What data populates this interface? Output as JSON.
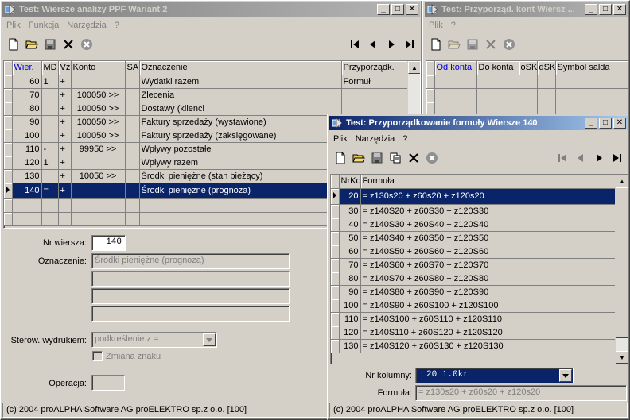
{
  "win1": {
    "title": "Test: Wiersze analizy PPF Wariant 2",
    "menu": [
      "Plik",
      "Funkcja",
      "Narzędzia",
      "?"
    ],
    "columns": [
      "Wier.",
      "MD",
      "Vz",
      "Konto",
      "SA",
      "Oznaczenie",
      "Przyporządk."
    ],
    "rows": [
      {
        "wier": "60",
        "md": "1",
        "vz": "+",
        "konto": "",
        "sa": "",
        "ozn": "Wydatki razem",
        "przyp": "Formuł"
      },
      {
        "wier": "70",
        "md": "",
        "vz": "+",
        "konto": "100050 >>",
        "sa": "",
        "ozn": "Zlecenia",
        "przyp": ""
      },
      {
        "wier": "80",
        "md": "",
        "vz": "+",
        "konto": "100050 >>",
        "sa": "",
        "ozn": "Dostawy (klienci",
        "przyp": ""
      },
      {
        "wier": "90",
        "md": "",
        "vz": "+",
        "konto": "100050 >>",
        "sa": "",
        "ozn": "Faktury sprzedaży (wystawione)",
        "przyp": ""
      },
      {
        "wier": "100",
        "md": "",
        "vz": "+",
        "konto": "100050 >>",
        "sa": "",
        "ozn": "Faktury sprzedaży (zaksięgowane)",
        "przyp": ""
      },
      {
        "wier": "110",
        "md": "-",
        "vz": "+",
        "konto": "99950 >>",
        "sa": "",
        "ozn": "Wpływy pozostałe",
        "przyp": ""
      },
      {
        "wier": "120",
        "md": "1",
        "vz": "+",
        "konto": "",
        "sa": "",
        "ozn": "Wpływy razem",
        "przyp": ""
      },
      {
        "wier": "130",
        "md": "",
        "vz": "+",
        "konto": "10050 >>",
        "sa": "",
        "ozn": "Środki pieniężne (stan bieżący)",
        "przyp": ""
      },
      {
        "wier": "140",
        "md": "=",
        "vz": "+",
        "konto": "",
        "sa": "",
        "ozn": "Środki pieniężne (prognoza)",
        "przyp": ""
      }
    ],
    "form": {
      "nr_label": "Nr wiersza:",
      "nr_value": "140",
      "ozn_label": "Oznaczenie:",
      "ozn_value": "Środki pieniężne (prognoza)",
      "ster_label": "Sterow. wydrukiem:",
      "ster_value": "podkreślenie z =",
      "zmiana_label": "Zmiana znaku",
      "oper_label": "Operacja:"
    },
    "status": "(c) 2004 proALPHA Software AG  proELEKTRO sp.z o.o. [100]"
  },
  "win2": {
    "title": "Test: Przyporząd. kont Wiersz ...",
    "menu": [
      "Plik",
      "?"
    ],
    "columns": [
      "Od konta",
      "Do konta",
      "oSK",
      "dSK",
      "Symbol salda"
    ]
  },
  "win3": {
    "title": "Test: Przyporządkowanie formuły Wiersze 140",
    "menu": [
      "Plik",
      "Narzędzia",
      "?"
    ],
    "columns": [
      "NrKo",
      "Formuła"
    ],
    "rows": [
      {
        "nr": "20",
        "f": "= z130s20 + z60s20 + z120s20"
      },
      {
        "nr": "30",
        "f": "= z140S20 + z60S30 + z120S30"
      },
      {
        "nr": "40",
        "f": "= z140S30 + z60S40 + z120S40"
      },
      {
        "nr": "50",
        "f": "= z140S40 + z60S50 + z120S50"
      },
      {
        "nr": "60",
        "f": "= z140S50 + z60S60 + z120S60"
      },
      {
        "nr": "70",
        "f": "= z140S60 + z60S70 + z120S70"
      },
      {
        "nr": "80",
        "f": "= z140S70 + z60S80 + z120S80"
      },
      {
        "nr": "90",
        "f": "= z140S80 + z60S90 + z120S90"
      },
      {
        "nr": "100",
        "f": "= z140S90 + z60S100 + z120S100"
      },
      {
        "nr": "110",
        "f": "= z140S100 + z60S110 + z120S110"
      },
      {
        "nr": "120",
        "f": "= z140S110 + z60S120 + z120S120"
      },
      {
        "nr": "130",
        "f": "= z140S120 + z60S130 + z120S130"
      }
    ],
    "nrkol_label": "Nr kolumny:",
    "nrkol_value": "20 1.0kr",
    "formula_label": "Formuła:",
    "formula_value": "= z130s20 + z60s20 + z120s20",
    "status": "(c) 2004 proALPHA Software AG  proELEKTRO sp.z o.o. [100]"
  }
}
